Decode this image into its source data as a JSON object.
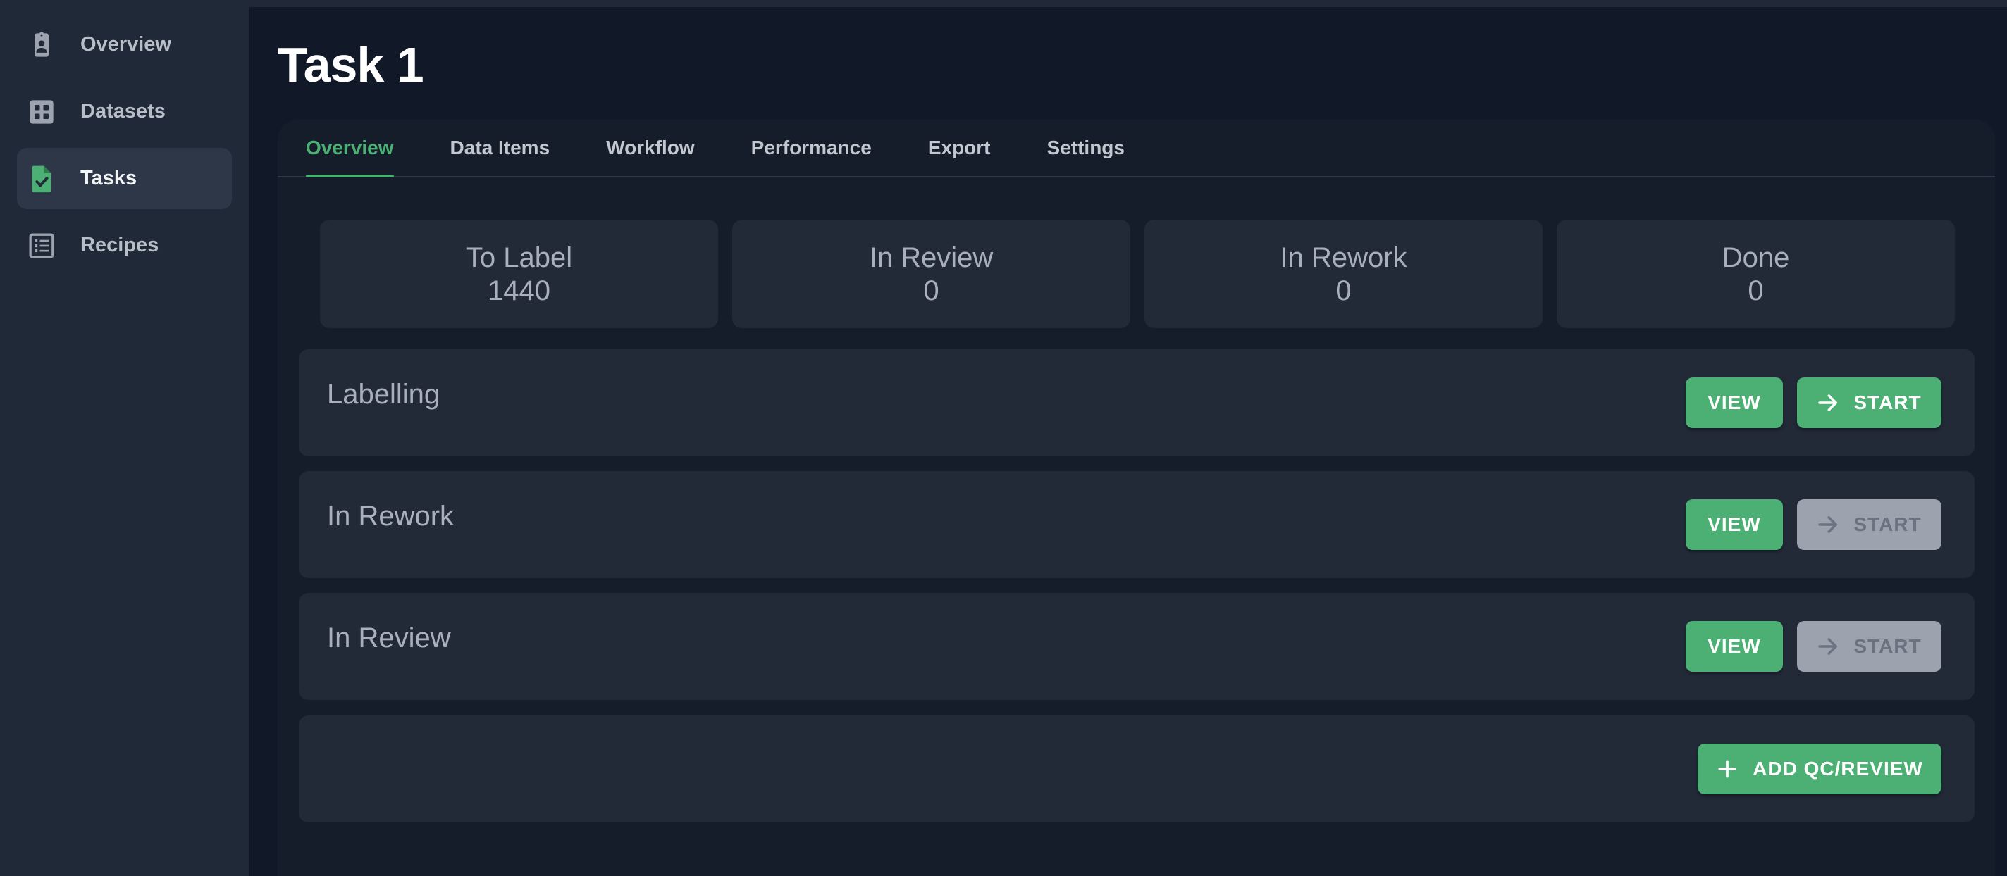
{
  "sidebar": {
    "items": [
      {
        "label": "Overview",
        "icon": "clipboard-user-icon",
        "active": false
      },
      {
        "label": "Datasets",
        "icon": "grid-icon",
        "active": false
      },
      {
        "label": "Tasks",
        "icon": "file-check-icon",
        "active": true
      },
      {
        "label": "Recipes",
        "icon": "list-icon",
        "active": false
      }
    ]
  },
  "page": {
    "title": "Task 1"
  },
  "tabs": [
    "Overview",
    "Data Items",
    "Workflow",
    "Performance",
    "Export",
    "Settings"
  ],
  "active_tab": "Overview",
  "stats": [
    {
      "label": "To Label",
      "value": "1440"
    },
    {
      "label": "In Review",
      "value": "0"
    },
    {
      "label": "In Rework",
      "value": "0"
    },
    {
      "label": "Done",
      "value": "0"
    }
  ],
  "stages": [
    {
      "title": "Labelling",
      "view_label": "VIEW",
      "start_label": "START",
      "start_enabled": true
    },
    {
      "title": "In Rework",
      "view_label": "VIEW",
      "start_label": "START",
      "start_enabled": false
    },
    {
      "title": "In Review",
      "view_label": "VIEW",
      "start_label": "START",
      "start_enabled": false
    }
  ],
  "add_review_label": "ADD QC/REVIEW",
  "colors": {
    "accent": "#4caf73",
    "background": "#111827",
    "sidebar": "#1f2937",
    "card": "#222a38",
    "disabled": "#9ca3af"
  }
}
